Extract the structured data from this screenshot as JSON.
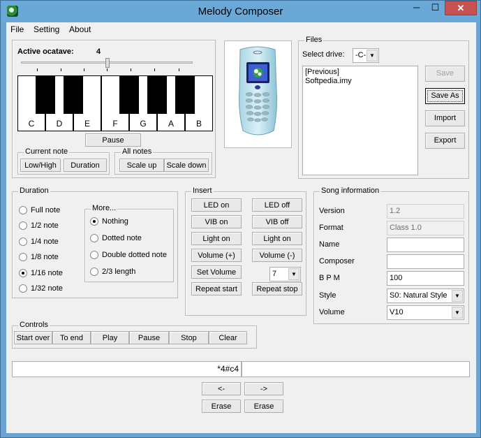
{
  "window": {
    "title": "Melody Composer",
    "min_glyph": "─",
    "max_glyph": "☐",
    "close_glyph": "✕"
  },
  "menu": [
    "File",
    "Setting",
    "About"
  ],
  "octave": {
    "label": "Active ocatave:",
    "value": "4"
  },
  "piano": {
    "keys": [
      "C",
      "D",
      "E",
      "F",
      "G",
      "A",
      "B"
    ]
  },
  "pause_button": "Pause",
  "current_note": {
    "title": "Current note",
    "low_high": "Low/High",
    "duration": "Duration"
  },
  "all_notes": {
    "title": "All notes",
    "scale_up": "Scale up",
    "scale_down": "Scale down"
  },
  "files": {
    "title": "Files",
    "select_drive_label": "Select drive:",
    "drive": "-C-",
    "list": [
      "[Previous]",
      "Softpedia.imy"
    ],
    "save": "Save",
    "save_as": "Save As",
    "import": "Import",
    "export": "Export"
  },
  "duration": {
    "title": "Duration",
    "options": [
      "Full note",
      "1/2 note",
      "1/4 note",
      "1/8 note",
      "1/16 note",
      "1/32 note"
    ],
    "selected": "1/16 note",
    "more_title": "More...",
    "more": [
      "Nothing",
      "Dotted note",
      "Double dotted note",
      "2/3 length"
    ],
    "more_selected": "Nothing"
  },
  "insert": {
    "title": "Insert",
    "led_on": "LED on",
    "led_off": "LED off",
    "vib_on": "VIB on",
    "vib_off": "VIB off",
    "light_on": "Light on",
    "light_off": "Light on",
    "volume_up": "Volume (+)",
    "volume_down": "Volume (-)",
    "set_volume": "Set Volume",
    "volume_value": "7",
    "repeat_start": "Repeat start",
    "repeat_stop": "Repeat stop"
  },
  "song": {
    "title": "Song information",
    "version_label": "Version",
    "version": "1.2",
    "format_label": "Format",
    "format": "Class 1.0",
    "name_label": "Name",
    "name": "",
    "composer_label": "Composer",
    "composer": "",
    "bpm_label": "B P M",
    "bpm": "100",
    "style_label": "Style",
    "style": "S0: Natural Style",
    "volume_label": "Volume",
    "volume": "V10"
  },
  "controls": {
    "title": "Controls",
    "buttons": [
      "Start over",
      "To end",
      "Play",
      "Pause",
      "Stop",
      "Clear"
    ]
  },
  "sequence": {
    "left": "*4#c4",
    "right": ""
  },
  "nav": {
    "back": "<-",
    "forward": "->",
    "erase_left": "Erase",
    "erase_right": "Erase"
  }
}
